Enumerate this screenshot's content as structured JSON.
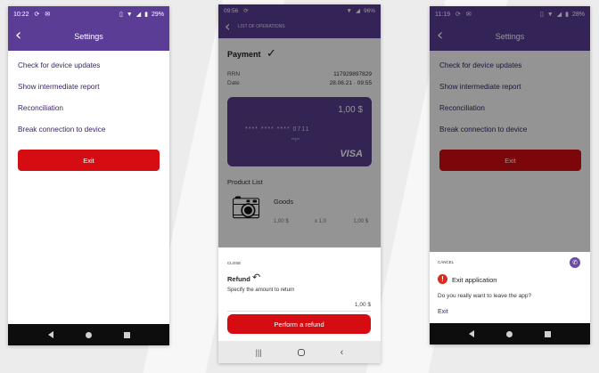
{
  "colors": {
    "purple": "#5b3d96",
    "red": "#d50d12",
    "dark_red": "#7e0f10"
  },
  "phone1": {
    "status": {
      "time": "10:22",
      "battery": "29%"
    },
    "title": "Settings",
    "menu": [
      "Check for device updates",
      "Show intermediate report",
      "Reconciliation",
      "Break connection to device"
    ],
    "exit_label": "Exit"
  },
  "phone2": {
    "status": {
      "time": "09:56",
      "battery": "96%"
    },
    "header_title": "LIST OF OPERATIONS",
    "payment_title": "Payment",
    "rrn_label": "RRN",
    "rrn_value": "117929897829",
    "date_label": "Date",
    "date_value": "28.06.21 · 09:55",
    "card_amount": "1,00 $",
    "card_number": "**** **** **** 0711",
    "card_expiry": "**/**",
    "card_brand": "VISA",
    "product_list_label": "Product List",
    "product_name": "Goods",
    "product_price": "1,00 $",
    "product_qty": "x 1,0",
    "product_total": "1,00 $",
    "sheet_close": "CLOSE",
    "refund_title": "Refund",
    "refund_sub": "Specify the amount to return",
    "refund_amount": "1,00 $",
    "refund_button": "Perform a refund"
  },
  "phone3": {
    "status": {
      "time": "11:19",
      "battery": "28%"
    },
    "title": "Settings",
    "menu": [
      "Check for device updates",
      "Show intermediate report",
      "Reconciliation",
      "Break connection to device"
    ],
    "exit_label": "Exit",
    "sheet_cancel": "CANCEL",
    "dialog_title": "Exit application",
    "dialog_text": "Do you really want to leave the app?",
    "dialog_exit": "Exit"
  }
}
